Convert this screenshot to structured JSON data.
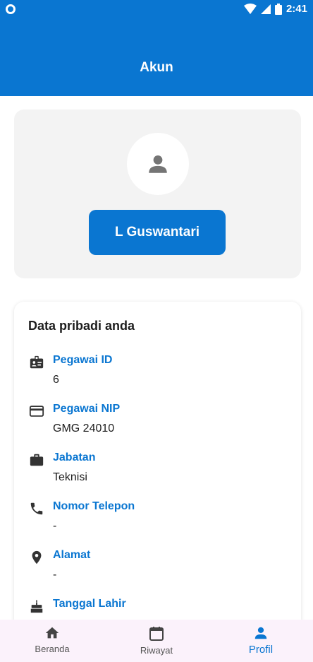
{
  "status_bar": {
    "time": "2:41"
  },
  "app_bar": {
    "title": "Akun"
  },
  "profile": {
    "name": "L Guswantari"
  },
  "personal_data": {
    "title": "Data pribadi anda",
    "items": [
      {
        "icon": "badge-icon",
        "label": "Pegawai ID",
        "value": "6"
      },
      {
        "icon": "credit-card-icon",
        "label": "Pegawai NIP",
        "value": "GMG 24010"
      },
      {
        "icon": "briefcase-icon",
        "label": "Jabatan",
        "value": "Teknisi"
      },
      {
        "icon": "phone-icon",
        "label": "Nomor Telepon",
        "value": "-"
      },
      {
        "icon": "location-pin-icon",
        "label": "Alamat",
        "value": "-"
      },
      {
        "icon": "cake-icon",
        "label": "Tanggal Lahir",
        "value": ""
      }
    ]
  },
  "bottom_nav": {
    "items": [
      {
        "label": "Beranda",
        "icon": "home-icon"
      },
      {
        "label": "Riwayat",
        "icon": "calendar-icon"
      },
      {
        "label": "Profil",
        "icon": "person-icon",
        "active": true
      }
    ]
  },
  "colors": {
    "primary": "#0a76d1",
    "card_bg": "#f3f3f3",
    "nav_bg": "#fbf2fb"
  }
}
